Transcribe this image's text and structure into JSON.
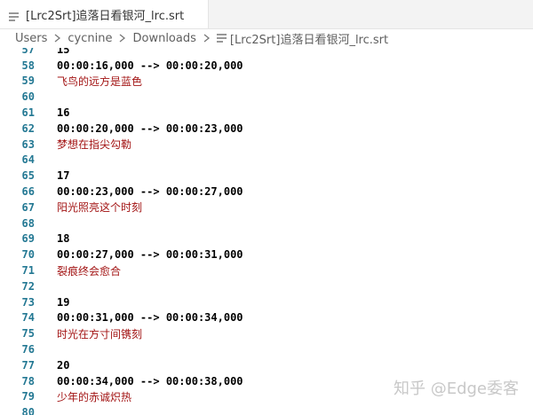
{
  "tab": {
    "title": "[Lrc2Srt]追落日看银河_lrc.srt"
  },
  "breadcrumb": {
    "items": [
      "Users",
      "cycnine",
      "Downloads"
    ],
    "file": "[Lrc2Srt]追落日看银河_lrc.srt"
  },
  "lines": [
    {
      "n": "57",
      "text": "15",
      "type": "code"
    },
    {
      "n": "58",
      "text": "00:00:16,000 --> 00:00:20,000",
      "type": "code"
    },
    {
      "n": "59",
      "text": "飞鸟的远方是蓝色",
      "type": "lyric"
    },
    {
      "n": "60",
      "text": "",
      "type": "code"
    },
    {
      "n": "61",
      "text": "16",
      "type": "code"
    },
    {
      "n": "62",
      "text": "00:00:20,000 --> 00:00:23,000",
      "type": "code"
    },
    {
      "n": "63",
      "text": "梦想在指尖勾勒",
      "type": "lyric"
    },
    {
      "n": "64",
      "text": "",
      "type": "code"
    },
    {
      "n": "65",
      "text": "17",
      "type": "code"
    },
    {
      "n": "66",
      "text": "00:00:23,000 --> 00:00:27,000",
      "type": "code"
    },
    {
      "n": "67",
      "text": "阳光照亮这个时刻",
      "type": "lyric"
    },
    {
      "n": "68",
      "text": "",
      "type": "code"
    },
    {
      "n": "69",
      "text": "18",
      "type": "code"
    },
    {
      "n": "70",
      "text": "00:00:27,000 --> 00:00:31,000",
      "type": "code"
    },
    {
      "n": "71",
      "text": "裂痕终会愈合",
      "type": "lyric"
    },
    {
      "n": "72",
      "text": "",
      "type": "code"
    },
    {
      "n": "73",
      "text": "19",
      "type": "code"
    },
    {
      "n": "74",
      "text": "00:00:31,000 --> 00:00:34,000",
      "type": "code"
    },
    {
      "n": "75",
      "text": "时光在方寸间镌刻",
      "type": "lyric"
    },
    {
      "n": "76",
      "text": "",
      "type": "code"
    },
    {
      "n": "77",
      "text": "20",
      "type": "code"
    },
    {
      "n": "78",
      "text": "00:00:34,000 --> 00:00:38,000",
      "type": "code"
    },
    {
      "n": "79",
      "text": "少年的赤诚炽热",
      "type": "lyric"
    },
    {
      "n": "80",
      "text": "",
      "type": "code"
    }
  ],
  "watermark": "知乎 @Edge委客",
  "colors": {
    "line_number": "#237893",
    "lyric_text": "#a31515",
    "code_text": "#000000"
  }
}
